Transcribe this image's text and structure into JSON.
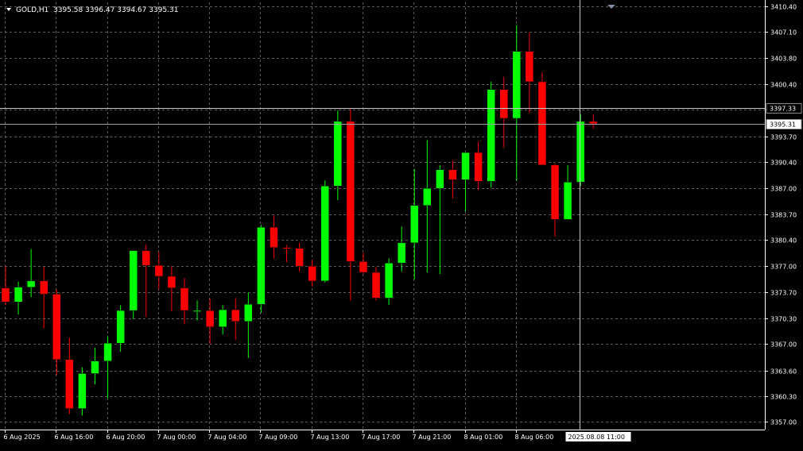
{
  "header": {
    "symbol": "GOLD,H1",
    "ohlc": "3395.58 3396.47 3394.67 3395.31"
  },
  "price_labels": {
    "horizontal_line": "3397.33",
    "current_price": "3395.31",
    "crosshair_time": "2025.08.08 11:00"
  },
  "colors": {
    "background": "#000000",
    "grid": "#5a5a5a",
    "bull": "#00ff00",
    "bear": "#ff0000",
    "wick_bull": "#00ff00",
    "wick_bear": "#ff0000",
    "axis_text": "#ffffff"
  },
  "chart_data": {
    "type": "candlestick",
    "symbol": "GOLD",
    "timeframe": "H1",
    "ylim": [
      3356.0,
      3410.9
    ],
    "y_ticks": [
      3410.4,
      3407.1,
      3403.8,
      3400.4,
      3397.1,
      3393.7,
      3390.4,
      3387.0,
      3383.7,
      3380.4,
      3377.0,
      3373.7,
      3370.3,
      3367.0,
      3363.6,
      3360.3,
      3357.0
    ],
    "y_tick_labels": [
      "3410.40",
      "3407.10",
      "3403.80",
      "3400.40",
      "3397.10",
      "3393.70",
      "3390.40",
      "3387.00",
      "3383.70",
      "3380.40",
      "3377.00",
      "3373.70",
      "3370.30",
      "3367.00",
      "3363.60",
      "3360.30",
      "3357.00"
    ],
    "x_tick_labels": [
      {
        "index": 0,
        "label": "6 Aug 2025"
      },
      {
        "index": 4,
        "label": "6 Aug 16:00"
      },
      {
        "index": 8,
        "label": "6 Aug 20:00"
      },
      {
        "index": 12,
        "label": "7 Aug 00:00"
      },
      {
        "index": 16,
        "label": "7 Aug 04:00"
      },
      {
        "index": 20,
        "label": "7 Aug 09:00"
      },
      {
        "index": 24,
        "label": "7 Aug 13:00"
      },
      {
        "index": 28,
        "label": "7 Aug 17:00"
      },
      {
        "index": 32,
        "label": "7 Aug 21:00"
      },
      {
        "index": 36,
        "label": "8 Aug 01:00"
      },
      {
        "index": 40,
        "label": "8 Aug 06:00"
      }
    ],
    "horizontal_line": 3397.33,
    "current_price": 3395.31,
    "crosshair_index": 45,
    "candles": [
      {
        "o": 3374.2,
        "h": 3377.0,
        "l": 3372.0,
        "c": 3372.4
      },
      {
        "o": 3372.4,
        "h": 3375.0,
        "l": 3370.8,
        "c": 3374.3
      },
      {
        "o": 3374.3,
        "h": 3379.2,
        "l": 3373.0,
        "c": 3375.1
      },
      {
        "o": 3375.1,
        "h": 3376.9,
        "l": 3369.0,
        "c": 3373.4
      },
      {
        "o": 3373.4,
        "h": 3374.0,
        "l": 3363.0,
        "c": 3365.0
      },
      {
        "o": 3365.0,
        "h": 3367.8,
        "l": 3358.0,
        "c": 3358.7
      },
      {
        "o": 3358.7,
        "h": 3364.0,
        "l": 3357.8,
        "c": 3363.2
      },
      {
        "o": 3363.2,
        "h": 3366.5,
        "l": 3361.8,
        "c": 3364.8
      },
      {
        "o": 3364.8,
        "h": 3368.0,
        "l": 3360.0,
        "c": 3367.1
      },
      {
        "o": 3367.1,
        "h": 3372.0,
        "l": 3366.0,
        "c": 3371.3
      },
      {
        "o": 3371.3,
        "h": 3379.0,
        "l": 3370.2,
        "c": 3379.0
      },
      {
        "o": 3379.0,
        "h": 3379.8,
        "l": 3370.5,
        "c": 3377.1
      },
      {
        "o": 3377.1,
        "h": 3378.8,
        "l": 3374.0,
        "c": 3375.7
      },
      {
        "o": 3375.7,
        "h": 3377.0,
        "l": 3371.2,
        "c": 3374.2
      },
      {
        "o": 3374.2,
        "h": 3375.5,
        "l": 3369.5,
        "c": 3371.3
      },
      {
        "o": 3371.3,
        "h": 3372.6,
        "l": 3370.0,
        "c": 3371.3
      },
      {
        "o": 3371.3,
        "h": 3372.8,
        "l": 3367.0,
        "c": 3369.2
      },
      {
        "o": 3369.2,
        "h": 3372.0,
        "l": 3368.2,
        "c": 3371.4
      },
      {
        "o": 3371.4,
        "h": 3372.9,
        "l": 3367.5,
        "c": 3369.9
      },
      {
        "o": 3369.9,
        "h": 3373.6,
        "l": 3365.2,
        "c": 3372.1
      },
      {
        "o": 3372.1,
        "h": 3382.3,
        "l": 3371.0,
        "c": 3382.0
      },
      {
        "o": 3382.0,
        "h": 3383.5,
        "l": 3378.0,
        "c": 3379.4
      },
      {
        "o": 3379.4,
        "h": 3379.7,
        "l": 3377.5,
        "c": 3379.3
      },
      {
        "o": 3379.3,
        "h": 3380.0,
        "l": 3376.3,
        "c": 3377.0
      },
      {
        "o": 3377.0,
        "h": 3377.8,
        "l": 3374.4,
        "c": 3375.1
      },
      {
        "o": 3375.1,
        "h": 3388.0,
        "l": 3374.9,
        "c": 3387.3
      },
      {
        "o": 3387.3,
        "h": 3397.0,
        "l": 3385.5,
        "c": 3395.6
      },
      {
        "o": 3395.6,
        "h": 3397.2,
        "l": 3372.6,
        "c": 3377.6
      },
      {
        "o": 3377.6,
        "h": 3378.7,
        "l": 3376.0,
        "c": 3376.2
      },
      {
        "o": 3376.2,
        "h": 3376.9,
        "l": 3372.6,
        "c": 3372.9
      },
      {
        "o": 3372.9,
        "h": 3378.0,
        "l": 3372.0,
        "c": 3377.4
      },
      {
        "o": 3377.4,
        "h": 3382.1,
        "l": 3376.3,
        "c": 3380.0
      },
      {
        "o": 3380.0,
        "h": 3389.5,
        "l": 3375.3,
        "c": 3384.8
      },
      {
        "o": 3384.8,
        "h": 3393.2,
        "l": 3376.2,
        "c": 3387.0
      },
      {
        "o": 3387.0,
        "h": 3390.0,
        "l": 3376.0,
        "c": 3389.4
      },
      {
        "o": 3389.4,
        "h": 3390.6,
        "l": 3385.7,
        "c": 3388.1
      },
      {
        "o": 3388.1,
        "h": 3391.5,
        "l": 3384.0,
        "c": 3391.6
      },
      {
        "o": 3391.6,
        "h": 3393.0,
        "l": 3386.8,
        "c": 3387.9
      },
      {
        "o": 3387.9,
        "h": 3400.7,
        "l": 3387.1,
        "c": 3399.7
      },
      {
        "o": 3399.7,
        "h": 3401.3,
        "l": 3392.2,
        "c": 3396.0
      },
      {
        "o": 3396.0,
        "h": 3408.0,
        "l": 3388.0,
        "c": 3404.6
      },
      {
        "o": 3404.6,
        "h": 3407.0,
        "l": 3396.7,
        "c": 3400.7
      },
      {
        "o": 3400.7,
        "h": 3401.9,
        "l": 3390.5,
        "c": 3390.0
      },
      {
        "o": 3390.0,
        "h": 3390.2,
        "l": 3380.8,
        "c": 3383.0
      },
      {
        "o": 3383.0,
        "h": 3390.0,
        "l": 3383.0,
        "c": 3387.8
      },
      {
        "o": 3387.8,
        "h": 3396.5,
        "l": 3387.3,
        "c": 3395.6
      },
      {
        "o": 3395.6,
        "h": 3396.5,
        "l": 3394.7,
        "c": 3395.3
      }
    ]
  }
}
